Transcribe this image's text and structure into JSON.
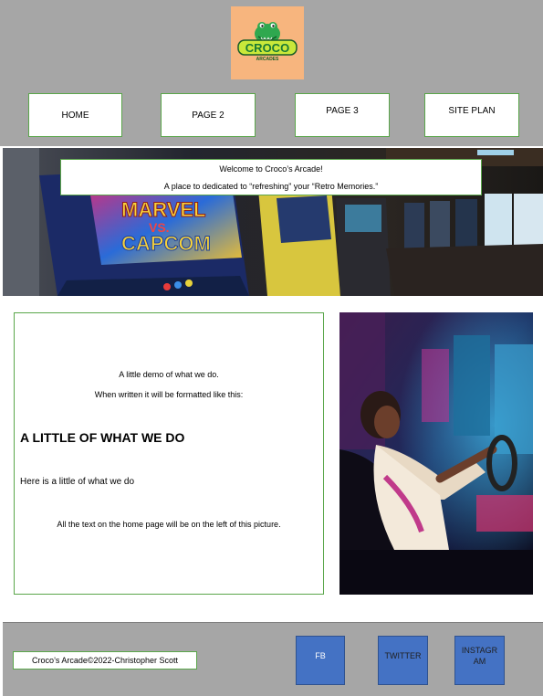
{
  "brand": {
    "logo_text": "CROCO",
    "logo_subtext": "ARCADES"
  },
  "nav": [
    {
      "label": "HOME"
    },
    {
      "label": "PAGE 2"
    },
    {
      "label": "PAGE 3"
    },
    {
      "label": "SITE PLAN"
    }
  ],
  "hero": {
    "welcome_line1": "Welcome to Croco’s Arcade!",
    "welcome_line2": "A place to dedicated to “refreshing” your “Retro Memories.”",
    "cabinet_text1": "MARVEL",
    "cabinet_text2": "VS.",
    "cabinet_text3": "CAPCOM"
  },
  "main": {
    "intro1": "A little demo of what we do.",
    "intro2": "When written it will be formatted like this:",
    "heading": "A LITTLE OF WHAT WE DO",
    "body": "Here is a little of what we do",
    "note": "All the text on the home page will be on the left of this picture."
  },
  "footer": {
    "copyright": "Croco’s Arcade©2022-Christopher Scott",
    "social": [
      {
        "label": "FB"
      },
      {
        "label": "TWITTER"
      },
      {
        "label": "INSTAGR AM"
      }
    ]
  },
  "colors": {
    "header_bg": "#a6a6a6",
    "logo_bg": "#f7b57e",
    "border_green": "#5aa64a",
    "social_blue": "#4472c4"
  }
}
